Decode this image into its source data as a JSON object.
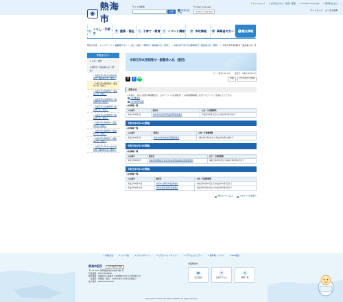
{
  "utility_links": [
    "サイトマップ",
    "文字の大きさ・色合い変更",
    "Foreign language",
    "音声読み上げ"
  ],
  "logo": {
    "name": "熱海市",
    "romanized": "Atami City"
  },
  "search": {
    "label": "サイト内検索",
    "placeholder": "",
    "button": "検索",
    "help": "検索の使い方"
  },
  "language": {
    "label": "Foreign language",
    "selected": "Select Language"
  },
  "header_right": [
    "サイトマップ",
    "よくある質問"
  ],
  "gnav": {
    "items": [
      {
        "label": "くらし・手続き",
        "icon": "⌂"
      },
      {
        "label": "健康・福祉",
        "icon": "♥"
      },
      {
        "label": "子育て・教育",
        "icon": "✎"
      },
      {
        "label": "イベント情報",
        "icon": "★"
      },
      {
        "label": "市政情報",
        "icon": "▦"
      },
      {
        "label": "事業者の方へ",
        "icon": "■"
      }
    ],
    "tourism": {
      "label": "観光情報",
      "icon": "✈"
    }
  },
  "breadcrumb": {
    "prefix": "現在の位置：",
    "items": [
      "トップページ",
      "事業者の方へ",
      "入札・契約",
      "制限付一般競争入札（委託）",
      "令和元年7月1日以降制限付一般競争入札（委託）"
    ],
    "current": "令和元年8月制限付一般競争入札（委託）"
  },
  "sidebar": {
    "header": "事業者の方へ",
    "sections": [
      {
        "label": "入札・契約",
        "subs": []
      },
      {
        "label": "制限付一般競争入札（委託）",
        "subs": [
          {
            "label": "令和元年7月1日以降の制限付一般競争入札（委託）",
            "active": false
          },
          {
            "label": "令和元年8月制限付一般競争入札（委託）",
            "active": true
          },
          {
            "label": "令和元年9月制限付一般競争入札（委託）",
            "active": false
          },
          {
            "label": "令和元年10月制限付一般競争入札（委託）",
            "active": false
          },
          {
            "label": "令和元年11月制限付一般競争入札（委託）",
            "active": false
          },
          {
            "label": "令和元年12月制限付一般競争入札（委託）",
            "active": false
          },
          {
            "label": "令和2年1月制限付一般競争入札（委託）",
            "active": false
          },
          {
            "label": "令和2年2月制限付一般競争入札（委託）",
            "active": false
          },
          {
            "label": "令和2年3月制限付一般競争入札（委託）",
            "active": false
          },
          {
            "label": "令和元年7月1日以前の制限付一般競争入札（委託）",
            "active": false
          }
        ]
      }
    ]
  },
  "main": {
    "title": "令和元年8月制限付一般競争入札（委託）",
    "page_id": "ページ番号1007278",
    "updated": "更新日：令和元年8月20日",
    "tools": [
      "印刷",
      "大きな文字で印刷"
    ],
    "sns": [
      "X",
      "f",
      "LINE"
    ],
    "notice_heading": "お知らせ",
    "notice_text": "入札者は、入札に必要な申請書式は、このページ（入札書様式）「入札参加申請書」はダウンロードして使用してください。",
    "doc_links": [
      "入札書様式",
      "入札参加申請書"
    ],
    "sections": [
      {
        "heading": "",
        "caption": "入札情報一覧",
        "headers": [
          "入札番号",
          "委託名",
          "公告・仕様書閲覧"
        ],
        "rows": [
          [
            "令和元年8月1日",
            "熱海市中央保育所給食調理業務委託",
            "令和元年8月1日から令和元年8月9日まで"
          ]
        ]
      },
      {
        "heading": "令和元年8月22日開催",
        "caption": "入札情報一覧",
        "headers": [
          "入札番号",
          "委託名",
          "公告・仕様書閲覧"
        ],
        "rows": [
          [
            "令和元年8月7日",
            "熱海市中学校給食調理業務委託",
            "令和元年8月7日から令和元年8月16日まで"
          ]
        ]
      },
      {
        "heading": "令和元年8月28日開催",
        "caption": "入札情報一覧",
        "headers": [
          "入札番号",
          "委託名",
          "公告・仕様書閲覧"
        ],
        "rows": [
          [
            "令和元年8月9日",
            "熱海市廃棄物処分場浸出水処理施設運転管理業務委託",
            "令和元年8月9日から令和元年8月20日まで"
          ]
        ]
      },
      {
        "heading": "令和元年9月14日開催",
        "caption": "入札情報一覧",
        "headers": [
          "入札番号",
          "委託名",
          "公告・仕様書閲覧"
        ],
        "rows": [
          [
            "令和元年8月20日",
            "熱海市公園等清掃業務委託",
            "令和元年8月20日から令和元年9月3日まで"
          ],
          [
            "令和元年8月20日",
            "熱海市道路清掃等業務委託",
            "令和元年8月20日から令和元年9月3日まで"
          ]
        ]
      }
    ],
    "page_nav": [
      "前のページへ戻る",
      "このページの先頭へ"
    ]
  },
  "footer": {
    "links": [
      "利用方法",
      "リンク集",
      "サイトポリシー",
      "プライバシーポリシー",
      "アクセシビリティ",
      "著作権・リンク",
      "RSS配信"
    ],
    "city_hall": {
      "name": "熱海市役所",
      "map_button": "熱海市役所の地図",
      "lines": [
        "〒413-8550 静岡県熱海市中央町1番1号",
        "代表電話：0557-86-6000",
        "開庁時間：月曜日から金曜日 午前8時30分から午後5時15分",
        "（土曜日・日曜日・祝日、12月29日から1月3日を除く）",
        "法人番号：8000020222054"
      ]
    },
    "guide": {
      "heading": "市役所案内",
      "buttons": [
        {
          "label": "窓口案内",
          "icon": "☎"
        },
        {
          "label": "交通アクセス",
          "icon": "⚑"
        },
        {
          "label": "部署一覧",
          "icon": "☰"
        }
      ]
    },
    "copyright": "Copyright © Atami City Official Website All rights reserved."
  }
}
